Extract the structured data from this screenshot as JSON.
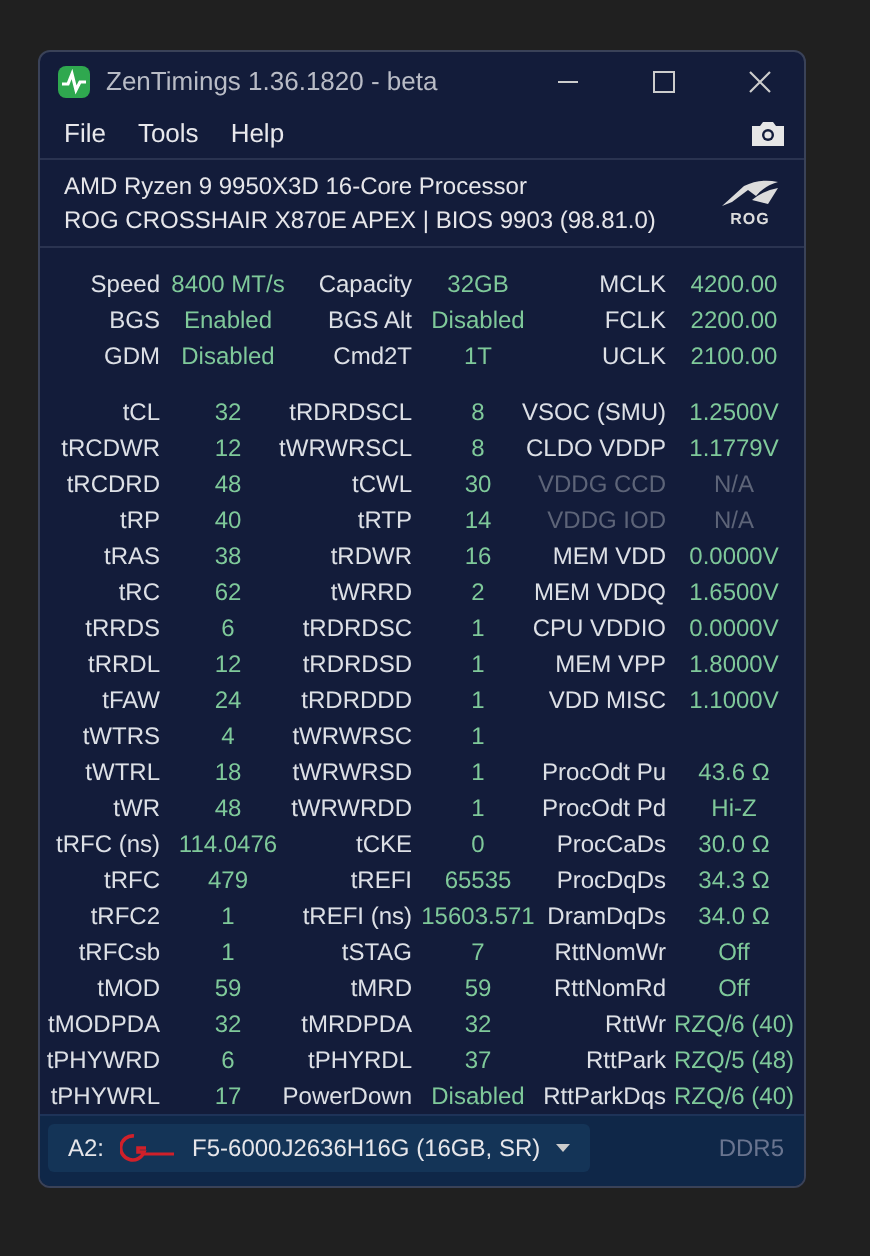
{
  "window": {
    "title": "ZenTimings 1.36.1820 - beta"
  },
  "menu": [
    "File",
    "Tools",
    "Help"
  ],
  "system": {
    "cpu": "AMD Ryzen 9 9950X3D 16-Core Processor",
    "board": "ROG CROSSHAIR X870E APEX | BIOS 9903 (98.81.0)",
    "logo_text": "ROG"
  },
  "summary": [
    [
      {
        "label": "Speed",
        "value": "8400 MT/s"
      },
      {
        "label": "Capacity",
        "value": "32GB"
      },
      {
        "label": "MCLK",
        "value": "4200.00"
      }
    ],
    [
      {
        "label": "BGS",
        "value": "Enabled"
      },
      {
        "label": "BGS Alt",
        "value": "Disabled"
      },
      {
        "label": "FCLK",
        "value": "2200.00"
      }
    ],
    [
      {
        "label": "GDM",
        "value": "Disabled"
      },
      {
        "label": "Cmd2T",
        "value": "1T"
      },
      {
        "label": "UCLK",
        "value": "2100.00"
      }
    ]
  ],
  "timings": [
    [
      {
        "label": "tCL",
        "value": "32",
        "disabled": false
      },
      {
        "label": "tRDRDSCL",
        "value": "8",
        "disabled": false
      },
      {
        "label": "VSOC (SMU)",
        "value": "1.2500V",
        "disabled": false
      }
    ],
    [
      {
        "label": "tRCDWR",
        "value": "12",
        "disabled": false
      },
      {
        "label": "tWRWRSCL",
        "value": "8",
        "disabled": false
      },
      {
        "label": "CLDO VDDP",
        "value": "1.1779V",
        "disabled": false
      }
    ],
    [
      {
        "label": "tRCDRD",
        "value": "48",
        "disabled": false
      },
      {
        "label": "tCWL",
        "value": "30",
        "disabled": false
      },
      {
        "label": "VDDG CCD",
        "value": "N/A",
        "disabled": true
      }
    ],
    [
      {
        "label": "tRP",
        "value": "40",
        "disabled": false
      },
      {
        "label": "tRTP",
        "value": "14",
        "disabled": false
      },
      {
        "label": "VDDG IOD",
        "value": "N/A",
        "disabled": true
      }
    ],
    [
      {
        "label": "tRAS",
        "value": "38",
        "disabled": false
      },
      {
        "label": "tRDWR",
        "value": "16",
        "disabled": false
      },
      {
        "label": "MEM VDD",
        "value": "0.0000V",
        "disabled": false
      }
    ],
    [
      {
        "label": "tRC",
        "value": "62",
        "disabled": false
      },
      {
        "label": "tWRRD",
        "value": "2",
        "disabled": false
      },
      {
        "label": "MEM VDDQ",
        "value": "1.6500V",
        "disabled": false
      }
    ],
    [
      {
        "label": "tRRDS",
        "value": "6",
        "disabled": false
      },
      {
        "label": "tRDRDSC",
        "value": "1",
        "disabled": false
      },
      {
        "label": "CPU VDDIO",
        "value": "0.0000V",
        "disabled": false
      }
    ],
    [
      {
        "label": "tRRDL",
        "value": "12",
        "disabled": false
      },
      {
        "label": "tRDRDSD",
        "value": "1",
        "disabled": false
      },
      {
        "label": "MEM VPP",
        "value": "1.8000V",
        "disabled": false
      }
    ],
    [
      {
        "label": "tFAW",
        "value": "24",
        "disabled": false
      },
      {
        "label": "tRDRDDD",
        "value": "1",
        "disabled": false
      },
      {
        "label": "VDD MISC",
        "value": "1.1000V",
        "disabled": false
      }
    ],
    [
      {
        "label": "tWTRS",
        "value": "4",
        "disabled": false
      },
      {
        "label": "tWRWRSC",
        "value": "1",
        "disabled": false
      }
    ],
    [
      {
        "label": "tWTRL",
        "value": "18",
        "disabled": false
      },
      {
        "label": "tWRWRSD",
        "value": "1",
        "disabled": false
      },
      {
        "label": "ProcOdt Pu",
        "value": "43.6 Ω",
        "disabled": false
      }
    ],
    [
      {
        "label": "tWR",
        "value": "48",
        "disabled": false
      },
      {
        "label": "tWRWRDD",
        "value": "1",
        "disabled": false
      },
      {
        "label": "ProcOdt Pd",
        "value": "Hi-Z",
        "disabled": false
      }
    ],
    [
      {
        "label": "tRFC (ns)",
        "value": "114.0476",
        "disabled": false
      },
      {
        "label": "tCKE",
        "value": "0",
        "disabled": false
      },
      {
        "label": "ProcCaDs",
        "value": "30.0 Ω",
        "disabled": false
      }
    ],
    [
      {
        "label": "tRFC",
        "value": "479",
        "disabled": false
      },
      {
        "label": "tREFI",
        "value": "65535",
        "disabled": false
      },
      {
        "label": "ProcDqDs",
        "value": "34.3 Ω",
        "disabled": false
      }
    ],
    [
      {
        "label": "tRFC2",
        "value": "1",
        "disabled": false
      },
      {
        "label": "tREFI (ns)",
        "value": "15603.571",
        "disabled": false
      },
      {
        "label": "DramDqDs",
        "value": "34.0 Ω",
        "disabled": false
      }
    ],
    [
      {
        "label": "tRFCsb",
        "value": "1",
        "disabled": false
      },
      {
        "label": "tSTAG",
        "value": "7",
        "disabled": false
      },
      {
        "label": "RttNomWr",
        "value": "Off",
        "disabled": false
      }
    ],
    [
      {
        "label": "tMOD",
        "value": "59",
        "disabled": false
      },
      {
        "label": "tMRD",
        "value": "59",
        "disabled": false
      },
      {
        "label": "RttNomRd",
        "value": "Off",
        "disabled": false
      }
    ],
    [
      {
        "label": "tMODPDA",
        "value": "32",
        "disabled": false
      },
      {
        "label": "tMRDPDA",
        "value": "32",
        "disabled": false
      },
      {
        "label": "RttWr",
        "value": "RZQ/6 (40)",
        "disabled": false
      }
    ],
    [
      {
        "label": "tPHYWRD",
        "value": "6",
        "disabled": false
      },
      {
        "label": "tPHYRDL",
        "value": "37",
        "disabled": false
      },
      {
        "label": "RttPark",
        "value": "RZQ/5 (48)",
        "disabled": false
      }
    ],
    [
      {
        "label": "tPHYWRL",
        "value": "17",
        "disabled": false
      },
      {
        "label": "PowerDown",
        "value": "Disabled",
        "disabled": false
      },
      {
        "label": "RttParkDqs",
        "value": "RZQ/6 (40)",
        "disabled": false
      }
    ]
  ],
  "footer": {
    "slot": "A2:",
    "module": "F5-6000J2636H16G (16GB, SR)",
    "memory_type": "DDR5"
  }
}
